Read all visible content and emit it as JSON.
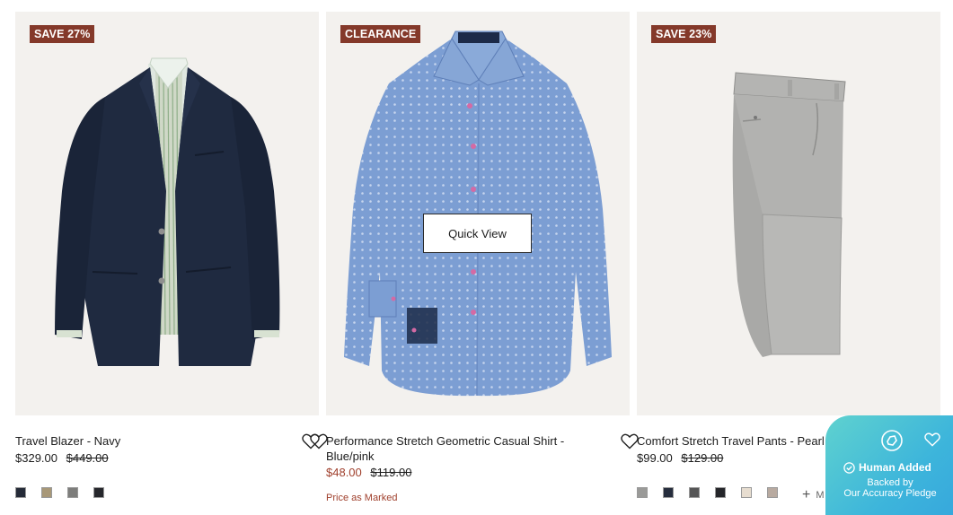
{
  "products": [
    {
      "badge": "SAVE 27%",
      "name": "Travel Blazer - Navy",
      "price": "$329.00",
      "original_price": "$449.00",
      "swatches": [
        "#252b38",
        "#a89878",
        "#7d7d7b",
        "#26272c"
      ]
    },
    {
      "badge": "CLEARANCE",
      "name": "Performance Stretch Geometric Casual Shirt - Blue/pink",
      "price": "$48.00",
      "original_price": "$119.00",
      "note": "Price as Marked",
      "quick_view": "Quick View"
    },
    {
      "badge": "SAVE 23%",
      "name": "Comfort Stretch Travel Pants - Pearl Grey",
      "price": "$99.00",
      "original_price": "$129.00",
      "swatches": [
        "#9a9a98",
        "#262d3d",
        "#555556",
        "#25262a",
        "#e7ddd0",
        "#b8aaa0"
      ],
      "more_label": "MORE"
    }
  ],
  "pledge": {
    "headline": "Human Added",
    "subline_1": "Backed by",
    "subline_2": "Our Accuracy Pledge"
  },
  "colors": {
    "badge": "#84392a",
    "sale_price": "#a0402d",
    "image_bg": "#f3f1ee",
    "pledge_gradient": [
      "#5fd2cf",
      "#36a6dd"
    ]
  }
}
